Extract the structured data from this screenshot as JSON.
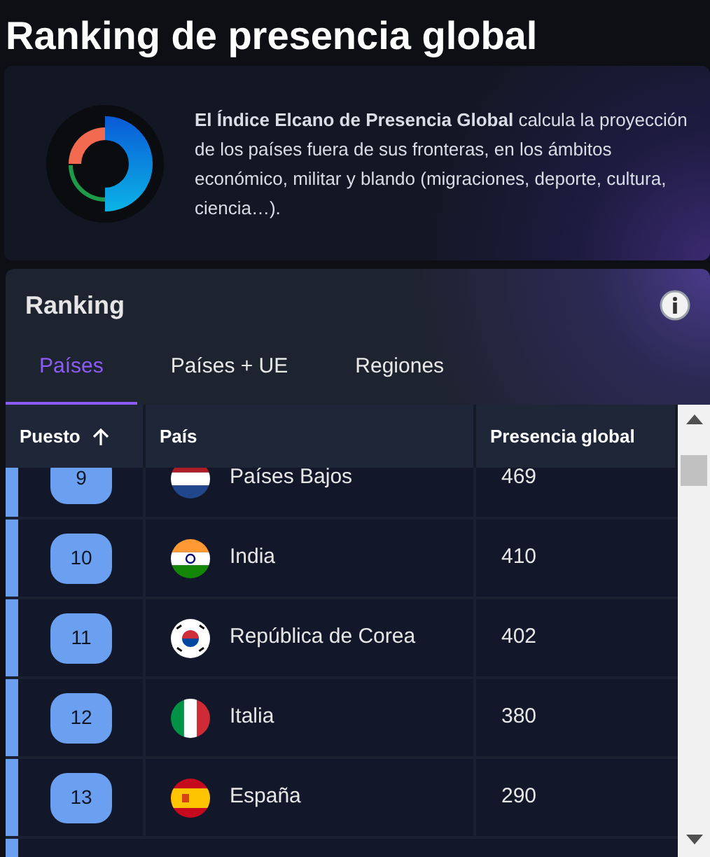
{
  "title": "Ranking de presencia global",
  "intro": "**El Índice Elcano de Presencia Global** calcula la proyección de los países fuera de sus fronteras, en los ámbitos económico, militar y blando (migraciones, deporte, cultura, ciencia…).",
  "ranking": {
    "title": "Ranking",
    "tabs": [
      {
        "label": "Países",
        "selected": true
      },
      {
        "label": "Países + UE",
        "selected": false
      },
      {
        "label": "Regiones",
        "selected": false
      }
    ],
    "columns": [
      "Puesto",
      "País",
      "Presencia global"
    ],
    "rows": [
      {
        "rank": "9",
        "country": "Países Bajos",
        "kind": "nl",
        "value": "469"
      },
      {
        "rank": "10",
        "country": "India",
        "kind": "in",
        "value": "410"
      },
      {
        "rank": "11",
        "country": "República de Corea",
        "kind": "kr",
        "value": "402"
      },
      {
        "rank": "12",
        "country": "Italia",
        "kind": "it",
        "value": "380"
      },
      {
        "rank": "13",
        "country": "España",
        "kind": "es",
        "value": "290"
      }
    ]
  }
}
